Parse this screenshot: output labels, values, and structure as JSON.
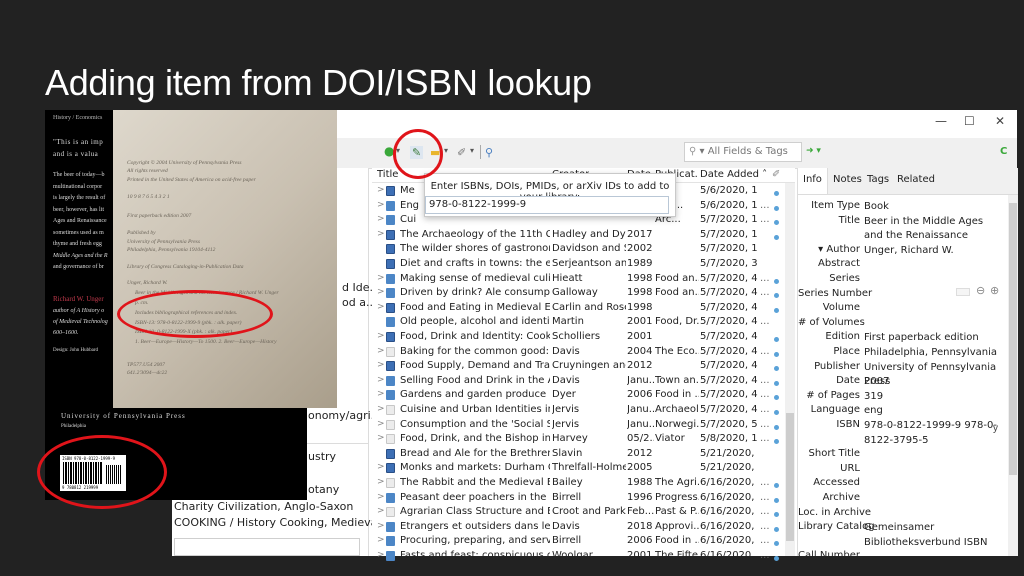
{
  "slide": {
    "title": "Adding item from DOI/ISBN lookup"
  },
  "window": {
    "controls": {
      "minimize": "—",
      "maximize": "☐",
      "close": "✕"
    }
  },
  "toolbar": {
    "new_item_icon": "●",
    "add_by_identifier_icon": "✎",
    "new_note_icon": "▬",
    "attach_icon": "✐",
    "advanced_search_icon": "⚲",
    "dropdown": "▾",
    "search_mode": "▾ All Fields & Tags",
    "search_icon": "⚲",
    "sync_icon": "C",
    "locate_icon": "➜ ▾"
  },
  "lookup_popup": {
    "label": "Enter ISBNs, DOIs, PMIDs, or arXiv IDs to add to your library:",
    "value": "978-0-8122-1999-9"
  },
  "left_pane": {
    "fragments": [
      "d Ide...",
      "od a...",
      "onomy/agri...",
      "ustry",
      "otany"
    ],
    "tags_line1": "Charity   Civilization, Anglo-Saxon",
    "tags_line2": "COOKING / History   Cooking, Medieval   Diet",
    "tag_filter_value": ""
  },
  "item_tree": {
    "columns": [
      "Title",
      "Creator",
      "Date",
      "Publicat...",
      "Date Added ˄"
    ],
    "rows": [
      {
        "type": "section",
        "twisty": ">",
        "title": "Me",
        "creator": "",
        "date": "",
        "pub": "",
        "added": "5/6/2020, 11:...",
        "more": "",
        "dot": true
      },
      {
        "type": "book",
        "twisty": ">",
        "title": "Eng",
        "creator": "",
        "date": "",
        "pub": "al R...",
        "added": "5/6/2020, 11:...",
        "more": "...",
        "dot": true
      },
      {
        "type": "book",
        "twisty": ">",
        "title": "Cui",
        "creator": "",
        "date": "",
        "pub": "Arc...",
        "added": "5/7/2020, 12:...",
        "more": "...",
        "dot": true
      },
      {
        "type": "section",
        "twisty": ">",
        "title": "The Archaeology of the 11th Centur...",
        "creator": "Hadley and Dyer",
        "date": "2017",
        "pub": "",
        "added": "5/7/2020, 12:...",
        "more": "",
        "dot": true
      },
      {
        "type": "section",
        "twisty": "",
        "title": "The wilder shores of gastronomy: t...",
        "creator": "Davidson and S...",
        "date": "2002",
        "pub": "",
        "added": "5/7/2020, 1:3...",
        "more": "",
        "dot": false
      },
      {
        "type": "section",
        "twisty": "",
        "title": "Diet and crafts in towns: the eviden...",
        "creator": "Serjeantson an...",
        "date": "1989",
        "pub": "",
        "added": "5/7/2020, 3:5...",
        "more": "",
        "dot": false
      },
      {
        "type": "book",
        "twisty": ">",
        "title": "Making sense of medieval culinary r...",
        "creator": "Hieatt",
        "date": "1998",
        "pub": "Food an...",
        "added": "5/7/2020, 4:1...",
        "more": "...",
        "dot": true
      },
      {
        "type": "book",
        "twisty": ">",
        "title": "Driven by drink? Ale consumption a...",
        "creator": "Galloway",
        "date": "1998",
        "pub": "Food an...",
        "added": "5/7/2020, 4:1...",
        "more": "...",
        "dot": true
      },
      {
        "type": "section",
        "twisty": ">",
        "title": "Food and Eating in Medieval Europe",
        "creator": "Carlin and Rose...",
        "date": "1998",
        "pub": "",
        "added": "5/7/2020, 4:1...",
        "more": "",
        "dot": true
      },
      {
        "type": "book",
        "twisty": "",
        "title": "Old people, alcohol and identity in ...",
        "creator": "Martin",
        "date": "2001",
        "pub": "Food, Dr...",
        "added": "5/7/2020, 4:2...",
        "more": "...",
        "dot": false
      },
      {
        "type": "section",
        "twisty": ">",
        "title": "Food, Drink and Identity: Cooking, E...",
        "creator": "Scholliers",
        "date": "2001",
        "pub": "",
        "added": "5/7/2020, 4:2...",
        "more": "",
        "dot": true
      },
      {
        "type": "article",
        "twisty": ">",
        "title": "Baking for the common good: a rea...",
        "creator": "Davis",
        "date": "2004",
        "pub": "The Eco...",
        "added": "5/7/2020, 4:2...",
        "more": "...",
        "dot": true
      },
      {
        "type": "section",
        "twisty": ">",
        "title": "Food Supply, Demand and Trade: A...",
        "creator": "Cruyningen and...",
        "date": "2012",
        "pub": "",
        "added": "5/7/2020, 4:2...",
        "more": "",
        "dot": true
      },
      {
        "type": "book",
        "twisty": ">",
        "title": "Selling Food and Drink in the After...",
        "creator": "Davis",
        "date": "Janu...",
        "pub": "Town an...",
        "added": "5/7/2020, 4:3...",
        "more": "...",
        "dot": true
      },
      {
        "type": "book",
        "twisty": ">",
        "title": "Gardens and garden produce in the...",
        "creator": "Dyer",
        "date": "2006",
        "pub": "Food in ...",
        "added": "5/7/2020, 4:4...",
        "more": "...",
        "dot": true
      },
      {
        "type": "article",
        "twisty": ">",
        "title": "Cuisine and Urban Identities in Med...",
        "creator": "Jervis",
        "date": "Janu...",
        "pub": "Archaeol...",
        "added": "5/7/2020, 4:5...",
        "more": "...",
        "dot": true
      },
      {
        "type": "article",
        "twisty": ">",
        "title": "Consumption and the 'Social Self' i...",
        "creator": "Jervis",
        "date": "Janu...",
        "pub": "Norwegi...",
        "added": "5/7/2020, 5:0...",
        "more": "...",
        "dot": true
      },
      {
        "type": "article",
        "twisty": ">",
        "title": "Food, Drink, and the Bishop in Medi...",
        "creator": "Harvey",
        "date": "05/2...",
        "pub": "Viator",
        "added": "5/8/2020, 11:...",
        "more": "...",
        "dot": true
      },
      {
        "type": "section",
        "twisty": "",
        "title": "Bread and Ale for the Brethren: The ...",
        "creator": "Slavin",
        "date": "2012",
        "pub": "",
        "added": "5/21/2020, 4:...",
        "more": "",
        "dot": false
      },
      {
        "type": "section",
        "twisty": ">",
        "title": "Monks and markets: Durham Cathe...",
        "creator": "Threlfall-Holmes",
        "date": "2005",
        "pub": "",
        "added": "5/21/2020, 4:...",
        "more": "",
        "dot": false
      },
      {
        "type": "article",
        "twisty": ">",
        "title": "The Rabbit and the Medieval East A...",
        "creator": "Bailey",
        "date": "1988",
        "pub": "The Agri...",
        "added": "6/16/2020, 1:...",
        "more": "...",
        "dot": true
      },
      {
        "type": "book",
        "twisty": ">",
        "title": "Peasant deer poachers in the medie...",
        "creator": "Birrell",
        "date": "1996",
        "pub": "Progress...",
        "added": "6/16/2020, 1:...",
        "more": "...",
        "dot": true
      },
      {
        "type": "article",
        "twisty": ">",
        "title": "Agrarian Class Structure and Econo...",
        "creator": "Croot and Parker",
        "date": "Feb....",
        "pub": "Past & P...",
        "added": "6/16/2020, 1:...",
        "more": "...",
        "dot": true
      },
      {
        "type": "book",
        "twisty": ">",
        "title": "Etrangers et outsiders dans les mar...",
        "creator": "Davis",
        "date": "2018",
        "pub": "Approvi...",
        "added": "6/16/2020, 2:...",
        "more": "...",
        "dot": true
      },
      {
        "type": "book",
        "twisty": ">",
        "title": "Procuring, preparing, and serving v...",
        "creator": "Birrell",
        "date": "2006",
        "pub": "Food in ...",
        "added": "6/16/2020, 5:...",
        "more": "...",
        "dot": true
      },
      {
        "type": "book",
        "twisty": ">",
        "title": "Fasts and feast: conspicuous consu...",
        "creator": "Woolgar",
        "date": "2001",
        "pub": "The Fifte...",
        "added": "6/16/2020, 6:...",
        "more": "...",
        "dot": true
      }
    ]
  },
  "item_pane": {
    "tabs": [
      "Info",
      "Notes",
      "Tags",
      "Related"
    ],
    "active_tab": "Info",
    "fields": [
      {
        "label": "Item Type",
        "value": "Book"
      },
      {
        "label": "Title",
        "value": "Beer in the Middle Ages and the Renaissance"
      },
      {
        "label": "▾  Author",
        "value": "Unger, Richard W."
      },
      {
        "label": "Abstract",
        "value": ""
      },
      {
        "label": "Series",
        "value": ""
      },
      {
        "label": "Series Number",
        "value": ""
      },
      {
        "label": "Volume",
        "value": ""
      },
      {
        "label": "# of Volumes",
        "value": ""
      },
      {
        "label": "Edition",
        "value": "First paperback edition"
      },
      {
        "label": "Place",
        "value": "Philadelphia, Pennsylvania"
      },
      {
        "label": "Publisher",
        "value": "University of Pennsylvania Press"
      },
      {
        "label": "Date",
        "value": "2007"
      },
      {
        "label": "# of Pages",
        "value": "319"
      },
      {
        "label": "Language",
        "value": "eng"
      },
      {
        "label": "ISBN",
        "value": "978-0-8122-1999-9 978-0-8122-3795-5"
      },
      {
        "label": "Short Title",
        "value": ""
      },
      {
        "label": "URL",
        "value": ""
      },
      {
        "label": "Accessed",
        "value": ""
      },
      {
        "label": "Archive",
        "value": ""
      },
      {
        "label": "Loc. in Archive",
        "value": ""
      },
      {
        "label": "Library Catalog",
        "value": "Gemeinsamer Bibliotheksverbund ISBN"
      },
      {
        "label": "Call Number",
        "value": ""
      }
    ],
    "date_suffix": "y",
    "author_controls": {
      "remove": "⊖",
      "add": "⊕"
    }
  },
  "cover_photo": {
    "category": "History / Economics",
    "quote1": "\"This is an imp",
    "quote2": "and is a valua",
    "blurb": [
      "The beer of today—b",
      "multinational corpor",
      "is largely the result of",
      "beer, however, has lit",
      "Ages and Renaissance",
      "sometimes used as m",
      "thyme and fresh egg",
      "Middle Ages and the R",
      "and governance of br"
    ],
    "author_line": "Richard W. Unger",
    "author_bio": [
      "author of A History o",
      "of Medieval Technolog",
      "600–1600."
    ],
    "designer": "Design: John Hubbard",
    "publisher": "University of Pennsylvania Press",
    "city": "Philadelphia",
    "barcode_text": "ISBN 978-0-8122-1999-9",
    "barcode_num": "9 780812 219999"
  },
  "copyright_photo": {
    "lines": [
      "Copyright © 2004 University of Pennsylvania Press",
      "All rights reserved",
      "Printed in the United States of America on acid-free paper",
      "10 9 8 7 6 5 4 3 2 1",
      "First paperback edition 2007",
      "Published by",
      "University of Pennsylvania Press",
      "Philadelphia, Pennsylvania 19104-4112",
      "Library of Congress Cataloging-in-Publication Data",
      "Unger, Richard W.",
      "Beer in the Middle Ages and the Renaissance / Richard W. Unger",
      "p. cm.",
      "Includes bibliographical references and index.",
      "ISBN-13: 978-0-8122-1999-9 (pbk. : alk. paper)",
      "ISBN-10: 0-8122-1999-X (pbk. : alk. paper)",
      "1. Beer—Europe—History—To 1500.  2. Beer—Europe—History",
      "TP577.U54  2007",
      "641.2'3094—dc22"
    ]
  }
}
